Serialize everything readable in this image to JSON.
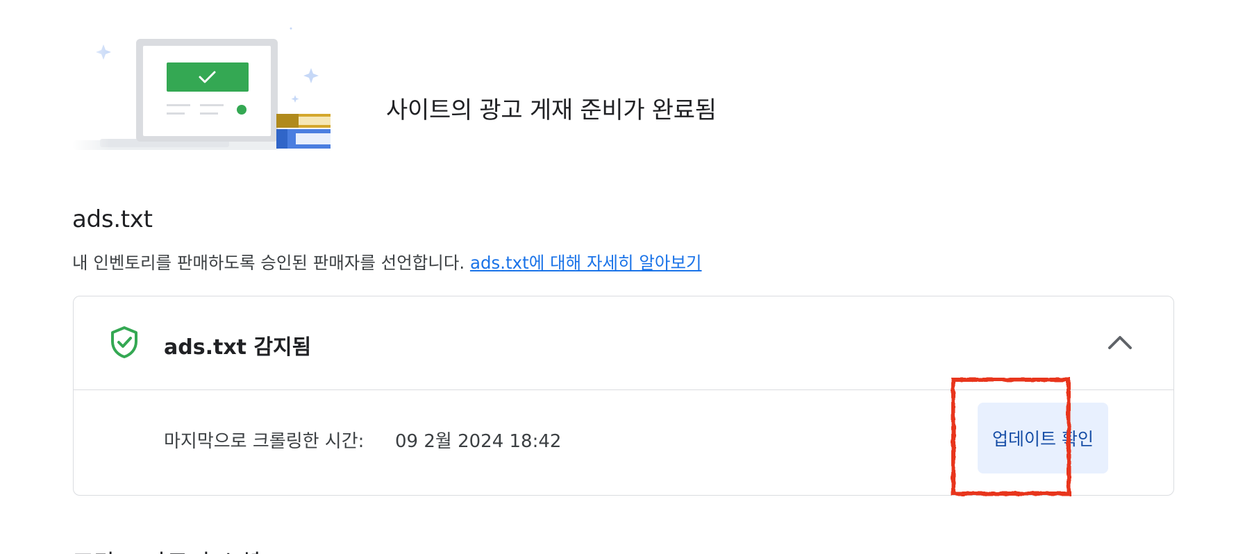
{
  "hero": {
    "title": "사이트의 광고 게재 준비가 완료됨"
  },
  "ads_txt": {
    "title": "ads.txt",
    "description": "내 인벤토리를 판매하도록 승인된 판매자를 선언합니다.",
    "learn_more_link": "ads.txt에 대해 자세히 알아보기",
    "card": {
      "status_title": "ads.txt 감지됨",
      "status_icon": "shield-check-icon",
      "expand_icon": "chevron-up-icon",
      "crawl_label": "마지막으로 크롤링한 시간:",
      "crawl_value": "09 2월 2024 18:42",
      "update_button_label": "업데이트 확인"
    }
  },
  "next_section": {
    "title": "프라그 파트너 소셜"
  },
  "colors": {
    "accent": "#1a73e8",
    "success": "#34a853",
    "button_bg": "#e8f0fe",
    "button_text": "#174ea6",
    "annotation": "#e8341c"
  }
}
